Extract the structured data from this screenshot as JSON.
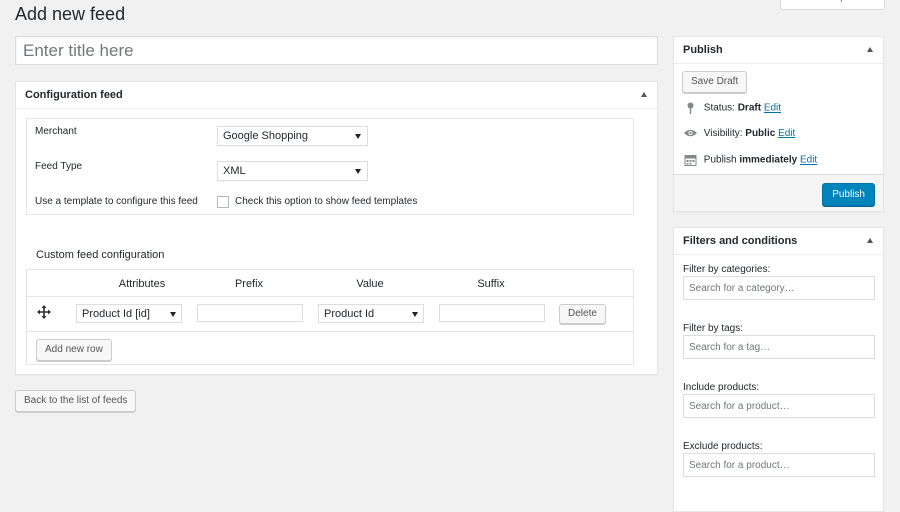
{
  "page": {
    "title": "Add new feed",
    "screen_options": "Screen Options",
    "title_placeholder": "Enter title here"
  },
  "config": {
    "title": "Configuration feed",
    "merchant_label": "Merchant",
    "merchant_value": "Google Shopping",
    "feed_type_label": "Feed Type",
    "feed_type_value": "XML",
    "template_label": "Use a template to configure this feed",
    "template_checkbox_label": "Check this option to show feed templates",
    "custom_title": "Custom feed configuration",
    "columns": [
      "Attributes",
      "Prefix",
      "Value",
      "Suffix"
    ],
    "row": {
      "attribute": "Product Id [id]",
      "value": "Product Id",
      "delete_label": "Delete"
    },
    "add_row_label": "Add new row"
  },
  "back_label": "Back to the list of feeds",
  "publish": {
    "title": "Publish",
    "save_draft_label": "Save Draft",
    "status_label": "Status:",
    "status_value": "Draft",
    "visibility_label": "Visibility:",
    "visibility_value": "Public",
    "publish_label": "Publish",
    "publish_value": "immediately",
    "edit_label": "Edit",
    "publish_button_label": "Publish"
  },
  "filters": {
    "title": "Filters and conditions",
    "categories_label": "Filter by categories:",
    "categories_placeholder": "Search for a category…",
    "tags_label": "Filter by tags:",
    "tags_placeholder": "Search for a tag…",
    "include_label": "Include products:",
    "include_placeholder": "Search for a product…",
    "exclude_label": "Exclude products:",
    "exclude_placeholder": "Search for a product…"
  },
  "colors": {
    "accent": "#0085ba",
    "link": "#0073aa",
    "background": "#f1f1f1"
  },
  "icons": [
    "chevron-up-icon",
    "move-icon",
    "pin-icon",
    "eye-icon",
    "calendar-icon",
    "dropdown-arrow-icon"
  ]
}
